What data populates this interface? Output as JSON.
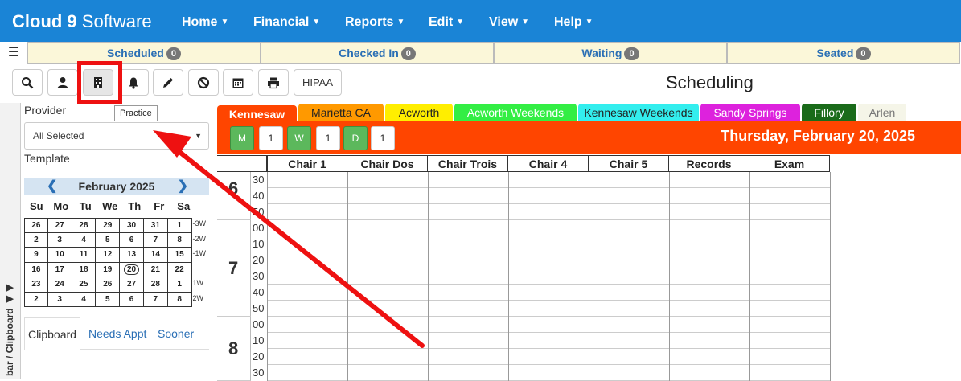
{
  "app": {
    "brand_bold": "Cloud 9",
    "brand_rest": " Software"
  },
  "nav": [
    "Home",
    "Financial",
    "Reports",
    "Edit",
    "View",
    "Help"
  ],
  "status": [
    {
      "label": "Scheduled",
      "count": "0"
    },
    {
      "label": "Checked In",
      "count": "0"
    },
    {
      "label": "Waiting",
      "count": "0"
    },
    {
      "label": "Seated",
      "count": "0"
    }
  ],
  "toolbar": {
    "icons": [
      "search-icon",
      "person-icon",
      "building-icon",
      "bell-icon",
      "pencil-icon",
      "ban-icon",
      "calendar-icon",
      "print-icon"
    ],
    "hipaa_label": "HIPAA",
    "tooltip": "Practice"
  },
  "page_title": "Scheduling",
  "sidebar": {
    "tab_label": "bar / Clipboard",
    "provider_label": "Provider",
    "provider_value": "All Selected",
    "template_label": "Template",
    "clip_tabs": [
      "Clipboard",
      "Needs Appt",
      "Sooner"
    ]
  },
  "calendar": {
    "month": "February 2025",
    "dow": [
      "Su",
      "Mo",
      "Tu",
      "We",
      "Th",
      "Fr",
      "Sa"
    ],
    "weeks": [
      {
        "days": [
          "26",
          "27",
          "28",
          "29",
          "30",
          "31",
          "1"
        ],
        "tag": "-3W"
      },
      {
        "days": [
          "2",
          "3",
          "4",
          "5",
          "6",
          "7",
          "8"
        ],
        "tag": "-2W"
      },
      {
        "days": [
          "9",
          "10",
          "11",
          "12",
          "13",
          "14",
          "15"
        ],
        "tag": "-1W"
      },
      {
        "days": [
          "16",
          "17",
          "18",
          "19",
          "20",
          "21",
          "22"
        ],
        "tag": ""
      },
      {
        "days": [
          "23",
          "24",
          "25",
          "26",
          "27",
          "28",
          "1"
        ],
        "tag": "1W"
      },
      {
        "days": [
          "2",
          "3",
          "4",
          "5",
          "6",
          "7",
          "8"
        ],
        "tag": "2W"
      }
    ],
    "today": "20"
  },
  "locations": [
    {
      "label": "Kennesaw",
      "bg": "#ff4500",
      "fg": "#ffffff"
    },
    {
      "label": "Marietta CA",
      "bg": "#ff9900",
      "fg": "#222222"
    },
    {
      "label": "Acworth",
      "bg": "#ffee00",
      "fg": "#222222"
    },
    {
      "label": "Acworth Weekends",
      "bg": "#33ee44",
      "fg": "#ffffff"
    },
    {
      "label": "Kennesaw Weekends",
      "bg": "#33eeee",
      "fg": "#222222"
    },
    {
      "label": "Sandy Springs",
      "bg": "#dd22dd",
      "fg": "#ffffff"
    },
    {
      "label": "Fillory",
      "bg": "#1a6b1a",
      "fg": "#ffffff"
    },
    {
      "label": "Arlen",
      "bg": "#f5f5e8",
      "fg": "#777777"
    }
  ],
  "chips": [
    {
      "label": "M",
      "count": "1"
    },
    {
      "label": "W",
      "count": "1"
    },
    {
      "label": "D",
      "count": "1"
    }
  ],
  "date": "Thursday, February 20, 2025",
  "columns": [
    "Chair 1",
    "Chair Dos",
    "Chair Trois",
    "Chair 4",
    "Chair 5",
    "Records",
    "Exam"
  ],
  "hours": [
    {
      "hour": "6",
      "minutes": [
        "30",
        "40",
        "50"
      ]
    },
    {
      "hour": "7",
      "minutes": [
        "00",
        "10",
        "20",
        "30",
        "40",
        "50"
      ]
    },
    {
      "hour": "8",
      "minutes": [
        "00",
        "10",
        "20",
        "30"
      ]
    }
  ]
}
